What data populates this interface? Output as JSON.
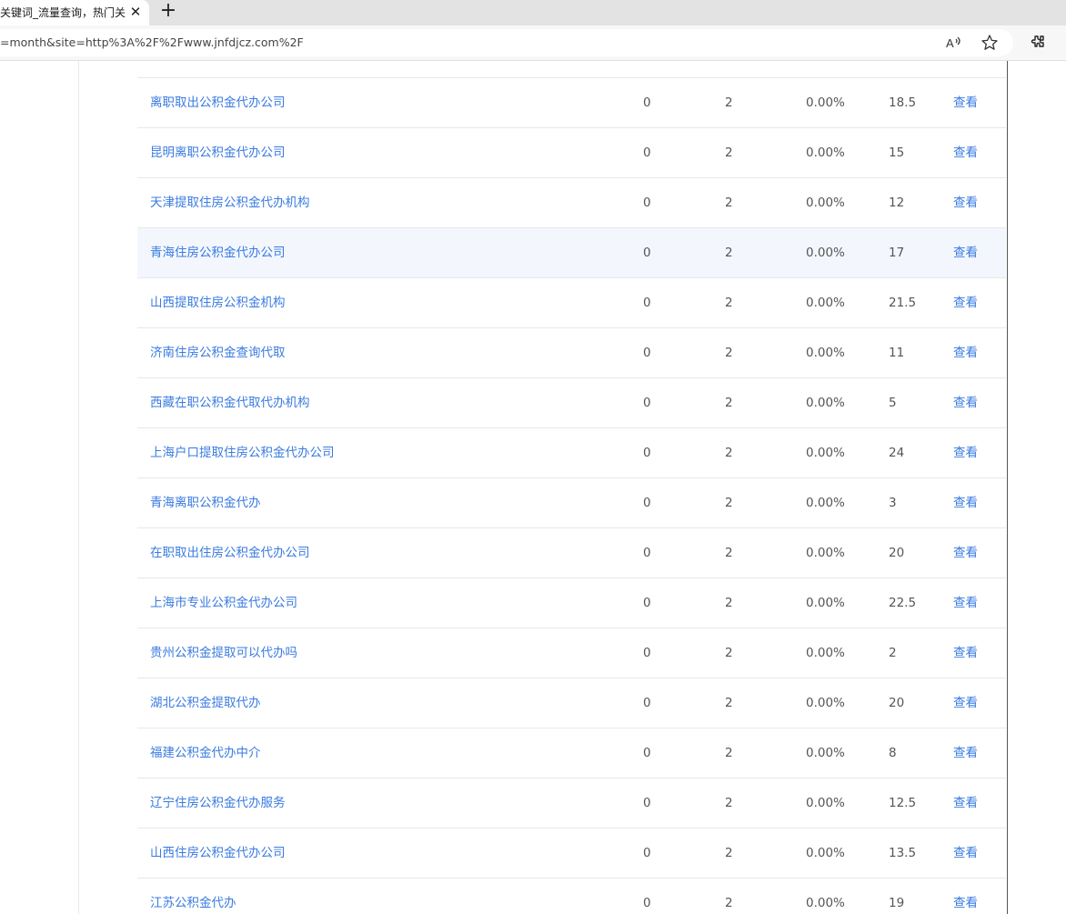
{
  "browser": {
    "tab_title": "关键词_流量查询，热门关键",
    "url": "=month&site=http%3A%2F%2Fwww.jnfdjcz.com%2F",
    "icons": [
      "close-icon",
      "plus-icon",
      "read-aloud-icon",
      "star-icon",
      "extensions-icon"
    ]
  },
  "table": {
    "action_label": "查看",
    "rows": [
      {
        "keyword": "离职取出公积金代办公司",
        "c1": "0",
        "c2": "2",
        "pct": "0.00%",
        "val": "18.5"
      },
      {
        "keyword": "昆明离职公积金代办公司",
        "c1": "0",
        "c2": "2",
        "pct": "0.00%",
        "val": "15"
      },
      {
        "keyword": "天津提取住房公积金代办机构",
        "c1": "0",
        "c2": "2",
        "pct": "0.00%",
        "val": "12"
      },
      {
        "keyword": "青海住房公积金代办公司",
        "c1": "0",
        "c2": "2",
        "pct": "0.00%",
        "val": "17"
      },
      {
        "keyword": "山西提取住房公积金机构",
        "c1": "0",
        "c2": "2",
        "pct": "0.00%",
        "val": "21.5"
      },
      {
        "keyword": "济南住房公积金查询代取",
        "c1": "0",
        "c2": "2",
        "pct": "0.00%",
        "val": "11"
      },
      {
        "keyword": "西藏在职公积金代取代办机构",
        "c1": "0",
        "c2": "2",
        "pct": "0.00%",
        "val": "5"
      },
      {
        "keyword": "上海户口提取住房公积金代办公司",
        "c1": "0",
        "c2": "2",
        "pct": "0.00%",
        "val": "24"
      },
      {
        "keyword": "青海离职公积金代办",
        "c1": "0",
        "c2": "2",
        "pct": "0.00%",
        "val": "3"
      },
      {
        "keyword": "在职取出住房公积金代办公司",
        "c1": "0",
        "c2": "2",
        "pct": "0.00%",
        "val": "20"
      },
      {
        "keyword": "上海市专业公积金代办公司",
        "c1": "0",
        "c2": "2",
        "pct": "0.00%",
        "val": "22.5"
      },
      {
        "keyword": "贵州公积金提取可以代办吗",
        "c1": "0",
        "c2": "2",
        "pct": "0.00%",
        "val": "2"
      },
      {
        "keyword": "湖北公积金提取代办",
        "c1": "0",
        "c2": "2",
        "pct": "0.00%",
        "val": "20"
      },
      {
        "keyword": "福建公积金代办中介",
        "c1": "0",
        "c2": "2",
        "pct": "0.00%",
        "val": "8"
      },
      {
        "keyword": "辽宁住房公积金代办服务",
        "c1": "0",
        "c2": "2",
        "pct": "0.00%",
        "val": "12.5"
      },
      {
        "keyword": "山西住房公积金代办公司",
        "c1": "0",
        "c2": "2",
        "pct": "0.00%",
        "val": "13.5"
      },
      {
        "keyword": "江苏公积金代办",
        "c1": "0",
        "c2": "2",
        "pct": "0.00%",
        "val": "19"
      }
    ]
  }
}
